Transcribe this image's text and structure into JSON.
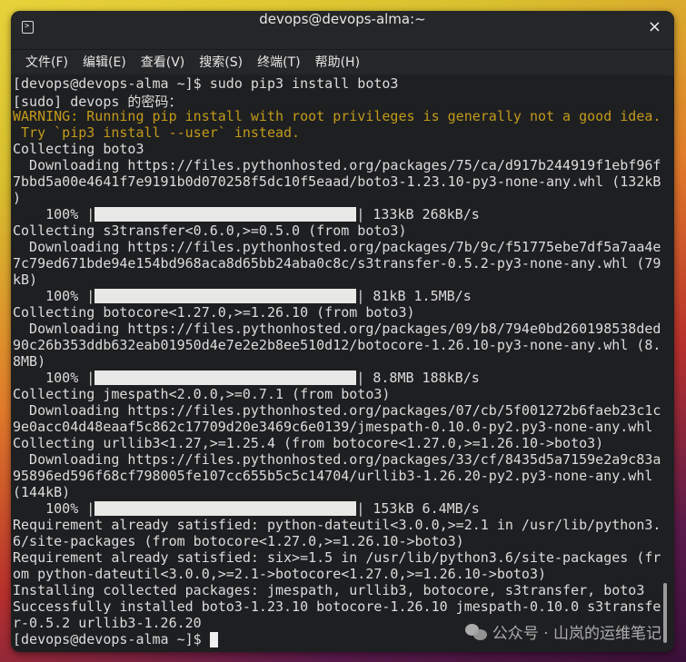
{
  "window": {
    "title": "devops@devops-alma:~",
    "close_label": "×"
  },
  "menu": [
    "文件(F)",
    "编辑(E)",
    "查看(V)",
    "搜索(S)",
    "终端(T)",
    "帮助(H)"
  ],
  "terminal": {
    "lines": [
      {
        "type": "normal",
        "text": "[devops@devops-alma ~]$ sudo pip3 install boto3"
      },
      {
        "type": "normal",
        "text": "[sudo] devops 的密码："
      },
      {
        "type": "warn",
        "text": "WARNING: Running pip install with root privileges is generally not a good idea."
      },
      {
        "type": "warn",
        "text": " Try `pip3 install --user` instead."
      },
      {
        "type": "normal",
        "text": "Collecting boto3"
      },
      {
        "type": "normal",
        "text": "  Downloading https://files.pythonhosted.org/packages/75/ca/d917b244919f1ebf96f"
      },
      {
        "type": "normal",
        "text": "7bbd5a00e4641f7e9191b0d070258f5dc10f5eaad/boto3-1.23.10-py3-none-any.whl (132kB"
      },
      {
        "type": "normal",
        "text": ")"
      },
      {
        "type": "progress",
        "text": "    100% |",
        "suffix": "| 133kB 268kB/s",
        "progress": 100
      },
      {
        "type": "normal",
        "text": "Collecting s3transfer<0.6.0,>=0.5.0 (from boto3)"
      },
      {
        "type": "normal",
        "text": "  Downloading https://files.pythonhosted.org/packages/7b/9c/f51775ebe7df5a7aa4e"
      },
      {
        "type": "normal",
        "text": "7c79ed671bde94e154bd968aca8d65bb24aba0c8c/s3transfer-0.5.2-py3-none-any.whl (79"
      },
      {
        "type": "normal",
        "text": "kB)"
      },
      {
        "type": "progress",
        "text": "    100% |",
        "suffix": "| 81kB 1.5MB/s",
        "progress": 100
      },
      {
        "type": "normal",
        "text": "Collecting botocore<1.27.0,>=1.26.10 (from boto3)"
      },
      {
        "type": "normal",
        "text": "  Downloading https://files.pythonhosted.org/packages/09/b8/794e0bd260198538ded"
      },
      {
        "type": "normal",
        "text": "90c26b353ddb632eab01950d4e7e2e2b8ee510d12/botocore-1.26.10-py3-none-any.whl (8."
      },
      {
        "type": "normal",
        "text": "8MB)"
      },
      {
        "type": "progress",
        "text": "    100% |",
        "suffix": "| 8.8MB 188kB/s",
        "progress": 100
      },
      {
        "type": "normal",
        "text": "Collecting jmespath<2.0.0,>=0.7.1 (from boto3)"
      },
      {
        "type": "normal",
        "text": "  Downloading https://files.pythonhosted.org/packages/07/cb/5f001272b6faeb23c1c"
      },
      {
        "type": "normal",
        "text": "9e0acc04d48eaaf5c862c17709d20e3469c6e0139/jmespath-0.10.0-py2.py3-none-any.whl"
      },
      {
        "type": "normal",
        "text": "Collecting urllib3<1.27,>=1.25.4 (from botocore<1.27.0,>=1.26.10->boto3)"
      },
      {
        "type": "normal",
        "text": "  Downloading https://files.pythonhosted.org/packages/33/cf/8435d5a7159e2a9c83a"
      },
      {
        "type": "normal",
        "text": "95896ed596f68cf798005fe107cc655b5c5c14704/urllib3-1.26.20-py2.py3-none-any.whl"
      },
      {
        "type": "normal",
        "text": "(144kB)"
      },
      {
        "type": "progress",
        "text": "    100% |",
        "suffix": "| 153kB 6.4MB/s",
        "progress": 100
      },
      {
        "type": "normal",
        "text": "Requirement already satisfied: python-dateutil<3.0.0,>=2.1 in /usr/lib/python3."
      },
      {
        "type": "normal",
        "text": "6/site-packages (from botocore<1.27.0,>=1.26.10->boto3)"
      },
      {
        "type": "normal",
        "text": "Requirement already satisfied: six>=1.5 in /usr/lib/python3.6/site-packages (fr"
      },
      {
        "type": "normal",
        "text": "om python-dateutil<3.0.0,>=2.1->botocore<1.27.0,>=1.26.10->boto3)"
      },
      {
        "type": "normal",
        "text": "Installing collected packages: jmespath, urllib3, botocore, s3transfer, boto3"
      },
      {
        "type": "normal",
        "text": "Successfully installed boto3-1.23.10 botocore-1.26.10 jmespath-0.10.0 s3transfe"
      },
      {
        "type": "normal",
        "text": "r-0.5.2 urllib3-1.26.20"
      },
      {
        "type": "prompt",
        "text": "[devops@devops-alma ~]$ "
      }
    ]
  },
  "watermark": "公众号 · 山岚的运维笔记",
  "colors": {
    "warning": "#c29a1a",
    "background": "#1e1f21",
    "text": "#dcdcdc"
  }
}
